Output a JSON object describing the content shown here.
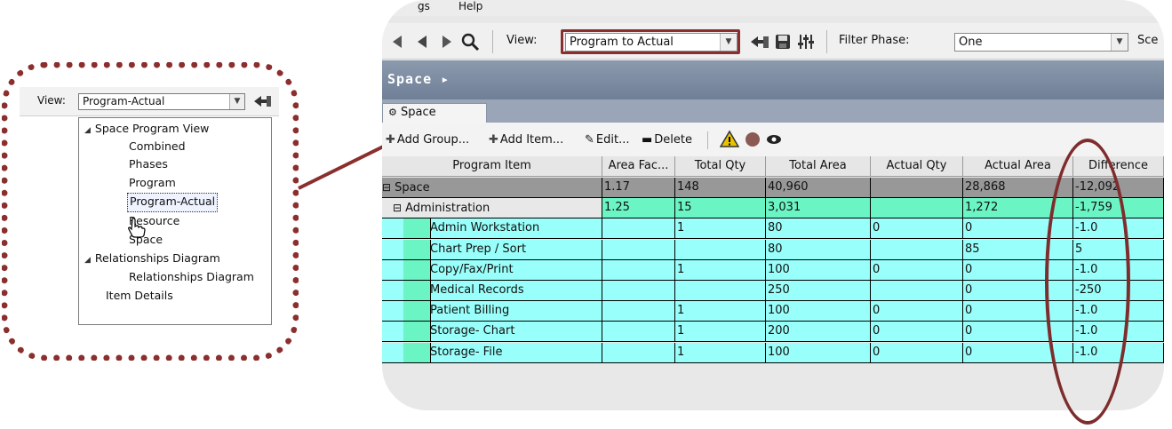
{
  "colors": {
    "accent_outline": "#8b2e2e",
    "row_group": "#6cf5c4",
    "row_item": "#99fffa",
    "row_space": "#989898"
  },
  "callout": {
    "view_label": "View:",
    "view_value": "Program-Actual",
    "tree": [
      {
        "label": "Space Program View",
        "icon": "collapse-triangle-icon"
      },
      {
        "label": "Combined"
      },
      {
        "label": "Phases"
      },
      {
        "label": "Program"
      },
      {
        "label": "Program-Actual"
      },
      {
        "label": "Resource"
      },
      {
        "label": "Space"
      },
      {
        "label": "Relationships Diagram",
        "icon": "collapse-triangle-icon"
      },
      {
        "label": "Relationships Diagram"
      },
      {
        "label": "Item Details"
      }
    ]
  },
  "app": {
    "menu": [
      "gs",
      "Help"
    ],
    "toolbar": {
      "view_label": "View:",
      "view_value": "Program to Actual",
      "filter_label": "Filter Phase:",
      "filter_value": "One",
      "trailing": "Sce"
    },
    "header_title": "Space",
    "tab_label": "Space",
    "actions": [
      "Add Group...",
      "Add Item...",
      "Edit...",
      "Delete"
    ],
    "columns": [
      "Program Item",
      "Area Fac...",
      "Total Qty",
      "Total Area",
      "Actual Qty",
      "Actual Area",
      "Difference"
    ],
    "rows": [
      {
        "kind": "space",
        "name": "Space",
        "area_factor": "1.17",
        "total_qty": "148",
        "total_area": "40,960",
        "actual_qty": "",
        "actual_area": "28,868",
        "difference": "-12,092"
      },
      {
        "kind": "group",
        "name": "Administration",
        "area_factor": "1.25",
        "total_qty": "15",
        "total_area": "3,031",
        "actual_qty": "",
        "actual_area": "1,272",
        "difference": "-1,759"
      },
      {
        "kind": "item",
        "name": "Admin Workstation",
        "area_factor": "",
        "total_qty": "1",
        "total_area": "80",
        "actual_qty": "0",
        "actual_area": "0",
        "difference": "-1.0"
      },
      {
        "kind": "item",
        "name": "Chart Prep / Sort",
        "area_factor": "",
        "total_qty": "",
        "total_area": "80",
        "actual_qty": "",
        "actual_area": "85",
        "difference": "5"
      },
      {
        "kind": "item",
        "name": "Copy/Fax/Print",
        "area_factor": "",
        "total_qty": "1",
        "total_area": "100",
        "actual_qty": "0",
        "actual_area": "0",
        "difference": "-1.0"
      },
      {
        "kind": "item",
        "name": "Medical Records",
        "area_factor": "",
        "total_qty": "",
        "total_area": "250",
        "actual_qty": "",
        "actual_area": "0",
        "difference": "-250"
      },
      {
        "kind": "item",
        "name": "Patient Billing",
        "area_factor": "",
        "total_qty": "1",
        "total_area": "100",
        "actual_qty": "0",
        "actual_area": "0",
        "difference": "-1.0"
      },
      {
        "kind": "item",
        "name": "Storage- Chart",
        "area_factor": "",
        "total_qty": "1",
        "total_area": "200",
        "actual_qty": "0",
        "actual_area": "0",
        "difference": "-1.0"
      },
      {
        "kind": "item",
        "name": "Storage- File",
        "area_factor": "",
        "total_qty": "1",
        "total_area": "100",
        "actual_qty": "0",
        "actual_area": "0",
        "difference": "-1.0"
      }
    ]
  }
}
